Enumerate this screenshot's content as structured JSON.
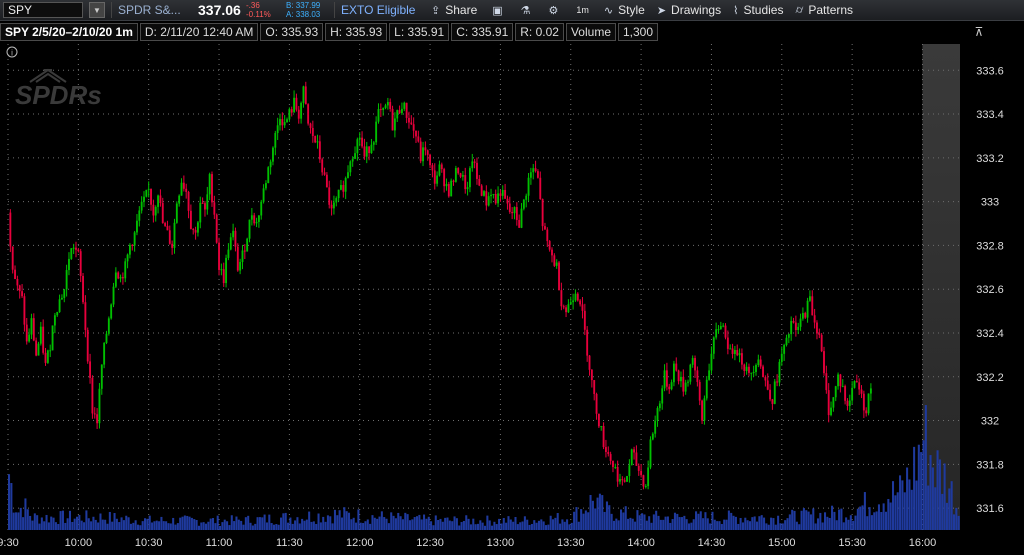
{
  "toolbar": {
    "symbol": "SPY",
    "description": "SPDR S&...",
    "last": "337.06",
    "change": "-.36",
    "change_pct": "-0.11%",
    "bid": "B: 337.99",
    "ask": "A: 338.03",
    "exto": "EXTO Eligible",
    "share": "Share",
    "interval": "1m",
    "style": "Style",
    "drawings": "Drawings",
    "studies": "Studies",
    "patterns": "Patterns"
  },
  "info": {
    "title": "SPY 2/5/20–2/10/20 1m",
    "date": "D: 2/11/20 12:40 AM",
    "open": "O: 335.93",
    "high": "H: 335.93",
    "low": "L: 335.91",
    "close": "C: 335.91",
    "range": "R: 0.02",
    "volume_label": "Volume",
    "volume": "1,300"
  },
  "watermark": "SPDRs",
  "info_icon": "i",
  "colors": {
    "up": "#00c000",
    "down": "#e8003c",
    "volume": "#1f3a9e",
    "grid": "#6f6f6f",
    "axis_text": "#dddddd"
  },
  "chart_data": {
    "type": "candlestick",
    "title": "",
    "xlabel": "",
    "ylabel": "",
    "x_ticks": [
      "9:30",
      "10:00",
      "10:30",
      "11:00",
      "11:30",
      "12:00",
      "12:30",
      "13:00",
      "13:30",
      "14:00",
      "14:30",
      "15:00",
      "15:30",
      "16:00"
    ],
    "y_ticks": [
      "331.6",
      "331.8",
      "332",
      "332.2",
      "332.4",
      "332.6",
      "332.8",
      "333",
      "333.2",
      "333.4",
      "333.6"
    ],
    "ylim": [
      331.5,
      333.72
    ],
    "x_range_minutes": [
      0,
      406
    ],
    "extended_hours_shaded_from_minute": 390,
    "grid": true,
    "close_path": [
      [
        0,
        332.95
      ],
      [
        2,
        332.7
      ],
      [
        4,
        332.6
      ],
      [
        6,
        332.55
      ],
      [
        8,
        332.35
      ],
      [
        10,
        332.45
      ],
      [
        12,
        332.3
      ],
      [
        14,
        332.4
      ],
      [
        16,
        332.25
      ],
      [
        18,
        332.35
      ],
      [
        20,
        332.5
      ],
      [
        22,
        332.55
      ],
      [
        24,
        332.6
      ],
      [
        26,
        332.75
      ],
      [
        28,
        332.8
      ],
      [
        30,
        332.75
      ],
      [
        32,
        332.55
      ],
      [
        34,
        332.3
      ],
      [
        36,
        332.05
      ],
      [
        38,
        332.0
      ],
      [
        40,
        332.25
      ],
      [
        42,
        332.4
      ],
      [
        44,
        332.55
      ],
      [
        46,
        332.7
      ],
      [
        48,
        332.65
      ],
      [
        50,
        332.7
      ],
      [
        52,
        332.8
      ],
      [
        54,
        332.85
      ],
      [
        56,
        332.95
      ],
      [
        58,
        333.0
      ],
      [
        60,
        333.05
      ],
      [
        62,
        332.95
      ],
      [
        64,
        333.05
      ],
      [
        66,
        332.9
      ],
      [
        68,
        332.85
      ],
      [
        70,
        332.8
      ],
      [
        72,
        333.0
      ],
      [
        74,
        333.1
      ],
      [
        76,
        333.05
      ],
      [
        78,
        332.9
      ],
      [
        80,
        332.85
      ],
      [
        82,
        333.0
      ],
      [
        84,
        332.95
      ],
      [
        86,
        333.1
      ],
      [
        88,
        332.95
      ],
      [
        90,
        332.7
      ],
      [
        92,
        332.65
      ],
      [
        94,
        332.8
      ],
      [
        96,
        332.85
      ],
      [
        98,
        332.7
      ],
      [
        100,
        332.75
      ],
      [
        102,
        332.85
      ],
      [
        104,
        332.95
      ],
      [
        106,
        332.9
      ],
      [
        108,
        333.0
      ],
      [
        110,
        333.1
      ],
      [
        112,
        333.2
      ],
      [
        114,
        333.3
      ],
      [
        116,
        333.4
      ],
      [
        118,
        333.35
      ],
      [
        120,
        333.4
      ],
      [
        122,
        333.45
      ],
      [
        124,
        333.4
      ],
      [
        126,
        333.5
      ],
      [
        128,
        333.35
      ],
      [
        130,
        333.3
      ],
      [
        132,
        333.25
      ],
      [
        134,
        333.15
      ],
      [
        136,
        333.05
      ],
      [
        138,
        332.95
      ],
      [
        140,
        333.0
      ],
      [
        142,
        333.05
      ],
      [
        144,
        333.1
      ],
      [
        146,
        333.2
      ],
      [
        148,
        333.25
      ],
      [
        150,
        333.3
      ],
      [
        152,
        333.2
      ],
      [
        154,
        333.25
      ],
      [
        156,
        333.3
      ],
      [
        158,
        333.4
      ],
      [
        160,
        333.4
      ],
      [
        162,
        333.45
      ],
      [
        164,
        333.35
      ],
      [
        166,
        333.4
      ],
      [
        168,
        333.45
      ],
      [
        170,
        333.4
      ],
      [
        172,
        333.35
      ],
      [
        174,
        333.3
      ],
      [
        176,
        333.2
      ],
      [
        178,
        333.25
      ],
      [
        180,
        333.15
      ],
      [
        182,
        333.1
      ],
      [
        184,
        333.15
      ],
      [
        186,
        333.1
      ],
      [
        188,
        333.05
      ],
      [
        190,
        333.1
      ],
      [
        192,
        333.15
      ],
      [
        194,
        333.1
      ],
      [
        196,
        333.05
      ],
      [
        198,
        333.2
      ],
      [
        200,
        333.1
      ],
      [
        202,
        333.05
      ],
      [
        204,
        333.0
      ],
      [
        206,
        333.05
      ],
      [
        208,
        333.0
      ],
      [
        210,
        333.05
      ],
      [
        212,
        333.0
      ],
      [
        214,
        332.95
      ],
      [
        216,
        332.95
      ],
      [
        218,
        332.9
      ],
      [
        220,
        333.0
      ],
      [
        222,
        333.1
      ],
      [
        224,
        333.15
      ],
      [
        226,
        333.1
      ],
      [
        228,
        332.9
      ],
      [
        230,
        332.8
      ],
      [
        232,
        332.75
      ],
      [
        234,
        332.7
      ],
      [
        236,
        332.55
      ],
      [
        238,
        332.5
      ],
      [
        240,
        332.55
      ],
      [
        242,
        332.6
      ],
      [
        244,
        332.55
      ],
      [
        246,
        332.4
      ],
      [
        248,
        332.25
      ],
      [
        250,
        332.1
      ],
      [
        252,
        332.0
      ],
      [
        254,
        331.9
      ],
      [
        256,
        331.85
      ],
      [
        258,
        331.8
      ],
      [
        260,
        331.75
      ],
      [
        262,
        331.7
      ],
      [
        264,
        331.75
      ],
      [
        266,
        331.85
      ],
      [
        268,
        331.8
      ],
      [
        270,
        331.75
      ],
      [
        272,
        331.7
      ],
      [
        274,
        331.9
      ],
      [
        276,
        332.0
      ],
      [
        278,
        332.1
      ],
      [
        280,
        332.2
      ],
      [
        282,
        332.15
      ],
      [
        284,
        332.25
      ],
      [
        286,
        332.2
      ],
      [
        288,
        332.15
      ],
      [
        290,
        332.2
      ],
      [
        292,
        332.3
      ],
      [
        294,
        332.15
      ],
      [
        296,
        332.0
      ],
      [
        298,
        332.2
      ],
      [
        300,
        332.3
      ],
      [
        302,
        332.4
      ],
      [
        304,
        332.45
      ],
      [
        306,
        332.4
      ],
      [
        308,
        332.3
      ],
      [
        310,
        332.35
      ],
      [
        312,
        332.3
      ],
      [
        314,
        332.25
      ],
      [
        316,
        332.2
      ],
      [
        318,
        332.25
      ],
      [
        320,
        332.3
      ],
      [
        322,
        332.2
      ],
      [
        324,
        332.15
      ],
      [
        326,
        332.1
      ],
      [
        328,
        332.2
      ],
      [
        330,
        332.3
      ],
      [
        332,
        332.35
      ],
      [
        334,
        332.45
      ],
      [
        336,
        332.4
      ],
      [
        338,
        332.45
      ],
      [
        340,
        332.5
      ],
      [
        342,
        332.55
      ],
      [
        344,
        332.45
      ],
      [
        346,
        332.4
      ],
      [
        348,
        332.2
      ],
      [
        350,
        332.05
      ],
      [
        352,
        332.1
      ],
      [
        354,
        332.2
      ],
      [
        356,
        332.15
      ],
      [
        358,
        332.05
      ],
      [
        360,
        332.15
      ],
      [
        362,
        332.2
      ],
      [
        364,
        332.1
      ],
      [
        366,
        332.05
      ],
      [
        368,
        332.15
      ]
    ],
    "volume_max": 10,
    "volume_profile": [
      [
        0,
        9
      ],
      [
        2,
        5
      ],
      [
        4,
        3
      ],
      [
        6,
        4
      ],
      [
        8,
        3
      ],
      [
        10,
        2
      ],
      [
        20,
        2
      ],
      [
        40,
        2
      ],
      [
        60,
        1.5
      ],
      [
        80,
        1.5
      ],
      [
        100,
        1.5
      ],
      [
        120,
        2
      ],
      [
        140,
        2.5
      ],
      [
        160,
        2
      ],
      [
        180,
        1.5
      ],
      [
        200,
        1.5
      ],
      [
        220,
        1.5
      ],
      [
        240,
        2
      ],
      [
        250,
        5
      ],
      [
        252,
        4
      ],
      [
        255,
        3
      ],
      [
        270,
        2
      ],
      [
        290,
        2
      ],
      [
        310,
        2
      ],
      [
        330,
        2
      ],
      [
        350,
        2.5
      ],
      [
        360,
        3
      ],
      [
        370,
        5
      ],
      [
        380,
        6
      ],
      [
        385,
        9
      ],
      [
        388,
        12
      ],
      [
        390,
        15
      ],
      [
        395,
        10
      ],
      [
        400,
        8
      ],
      [
        406,
        2
      ]
    ]
  }
}
